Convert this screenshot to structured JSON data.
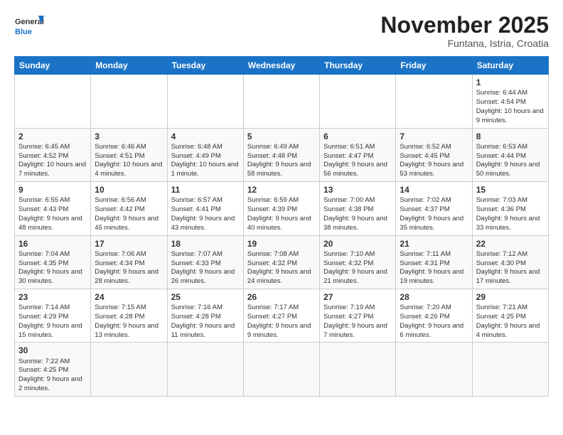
{
  "header": {
    "logo_general": "General",
    "logo_blue": "Blue",
    "month_title": "November 2025",
    "subtitle": "Funtana, Istria, Croatia"
  },
  "weekdays": [
    "Sunday",
    "Monday",
    "Tuesday",
    "Wednesday",
    "Thursday",
    "Friday",
    "Saturday"
  ],
  "weeks": [
    [
      {
        "num": "",
        "info": ""
      },
      {
        "num": "",
        "info": ""
      },
      {
        "num": "",
        "info": ""
      },
      {
        "num": "",
        "info": ""
      },
      {
        "num": "",
        "info": ""
      },
      {
        "num": "",
        "info": ""
      },
      {
        "num": "1",
        "info": "Sunrise: 6:44 AM\nSunset: 4:54 PM\nDaylight: 10 hours and 9 minutes."
      }
    ],
    [
      {
        "num": "2",
        "info": "Sunrise: 6:45 AM\nSunset: 4:52 PM\nDaylight: 10 hours and 7 minutes."
      },
      {
        "num": "3",
        "info": "Sunrise: 6:46 AM\nSunset: 4:51 PM\nDaylight: 10 hours and 4 minutes."
      },
      {
        "num": "4",
        "info": "Sunrise: 6:48 AM\nSunset: 4:49 PM\nDaylight: 10 hours and 1 minute."
      },
      {
        "num": "5",
        "info": "Sunrise: 6:49 AM\nSunset: 4:48 PM\nDaylight: 9 hours and 58 minutes."
      },
      {
        "num": "6",
        "info": "Sunrise: 6:51 AM\nSunset: 4:47 PM\nDaylight: 9 hours and 56 minutes."
      },
      {
        "num": "7",
        "info": "Sunrise: 6:52 AM\nSunset: 4:45 PM\nDaylight: 9 hours and 53 minutes."
      },
      {
        "num": "8",
        "info": "Sunrise: 6:53 AM\nSunset: 4:44 PM\nDaylight: 9 hours and 50 minutes."
      }
    ],
    [
      {
        "num": "9",
        "info": "Sunrise: 6:55 AM\nSunset: 4:43 PM\nDaylight: 9 hours and 48 minutes."
      },
      {
        "num": "10",
        "info": "Sunrise: 6:56 AM\nSunset: 4:42 PM\nDaylight: 9 hours and 45 minutes."
      },
      {
        "num": "11",
        "info": "Sunrise: 6:57 AM\nSunset: 4:41 PM\nDaylight: 9 hours and 43 minutes."
      },
      {
        "num": "12",
        "info": "Sunrise: 6:59 AM\nSunset: 4:39 PM\nDaylight: 9 hours and 40 minutes."
      },
      {
        "num": "13",
        "info": "Sunrise: 7:00 AM\nSunset: 4:38 PM\nDaylight: 9 hours and 38 minutes."
      },
      {
        "num": "14",
        "info": "Sunrise: 7:02 AM\nSunset: 4:37 PM\nDaylight: 9 hours and 35 minutes."
      },
      {
        "num": "15",
        "info": "Sunrise: 7:03 AM\nSunset: 4:36 PM\nDaylight: 9 hours and 33 minutes."
      }
    ],
    [
      {
        "num": "16",
        "info": "Sunrise: 7:04 AM\nSunset: 4:35 PM\nDaylight: 9 hours and 30 minutes."
      },
      {
        "num": "17",
        "info": "Sunrise: 7:06 AM\nSunset: 4:34 PM\nDaylight: 9 hours and 28 minutes."
      },
      {
        "num": "18",
        "info": "Sunrise: 7:07 AM\nSunset: 4:33 PM\nDaylight: 9 hours and 26 minutes."
      },
      {
        "num": "19",
        "info": "Sunrise: 7:08 AM\nSunset: 4:32 PM\nDaylight: 9 hours and 24 minutes."
      },
      {
        "num": "20",
        "info": "Sunrise: 7:10 AM\nSunset: 4:32 PM\nDaylight: 9 hours and 21 minutes."
      },
      {
        "num": "21",
        "info": "Sunrise: 7:11 AM\nSunset: 4:31 PM\nDaylight: 9 hours and 19 minutes."
      },
      {
        "num": "22",
        "info": "Sunrise: 7:12 AM\nSunset: 4:30 PM\nDaylight: 9 hours and 17 minutes."
      }
    ],
    [
      {
        "num": "23",
        "info": "Sunrise: 7:14 AM\nSunset: 4:29 PM\nDaylight: 9 hours and 15 minutes."
      },
      {
        "num": "24",
        "info": "Sunrise: 7:15 AM\nSunset: 4:28 PM\nDaylight: 9 hours and 13 minutes."
      },
      {
        "num": "25",
        "info": "Sunrise: 7:16 AM\nSunset: 4:28 PM\nDaylight: 9 hours and 11 minutes."
      },
      {
        "num": "26",
        "info": "Sunrise: 7:17 AM\nSunset: 4:27 PM\nDaylight: 9 hours and 9 minutes."
      },
      {
        "num": "27",
        "info": "Sunrise: 7:19 AM\nSunset: 4:27 PM\nDaylight: 9 hours and 7 minutes."
      },
      {
        "num": "28",
        "info": "Sunrise: 7:20 AM\nSunset: 4:26 PM\nDaylight: 9 hours and 6 minutes."
      },
      {
        "num": "29",
        "info": "Sunrise: 7:21 AM\nSunset: 4:25 PM\nDaylight: 9 hours and 4 minutes."
      }
    ],
    [
      {
        "num": "30",
        "info": "Sunrise: 7:22 AM\nSunset: 4:25 PM\nDaylight: 9 hours and 2 minutes."
      },
      {
        "num": "",
        "info": ""
      },
      {
        "num": "",
        "info": ""
      },
      {
        "num": "",
        "info": ""
      },
      {
        "num": "",
        "info": ""
      },
      {
        "num": "",
        "info": ""
      },
      {
        "num": "",
        "info": ""
      }
    ]
  ]
}
